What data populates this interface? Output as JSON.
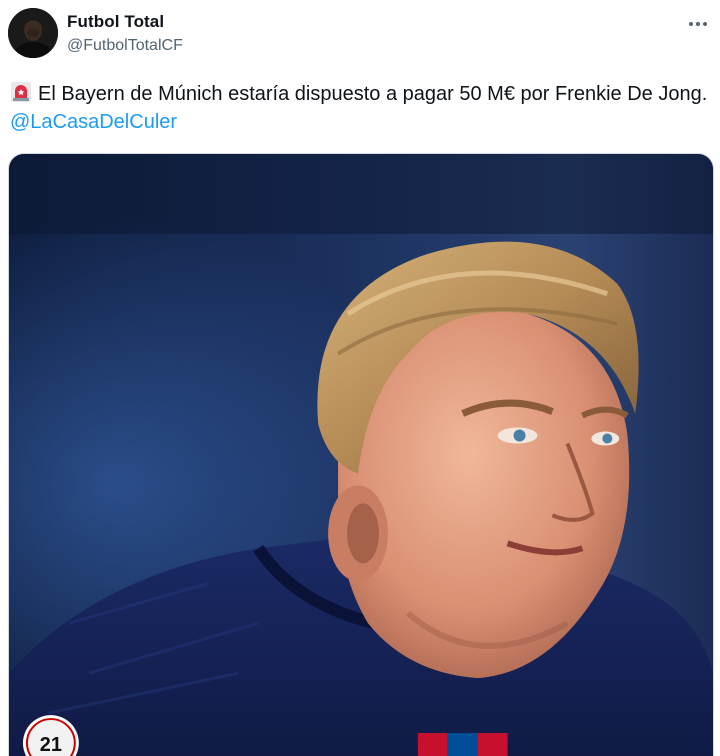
{
  "tweet": {
    "author": {
      "name": "Futbol Total",
      "handle": "@FutbolTotalCF",
      "avatar_icon": "profile-avatar"
    },
    "more_icon": "more-dots-icon",
    "emoji_icon": "rotating-light-icon",
    "text_main": "El Bayern de Múnich estaría dispuesto a pagar 50 M€ por Frenkie De Jong. ",
    "mention": "@LaCasaDelCuler",
    "media": {
      "kind": "photo",
      "jersey_number": "21"
    },
    "colors": {
      "link": "#1d9bf0",
      "secondary_text": "#536471",
      "alarm_red": "#e0245e"
    }
  }
}
